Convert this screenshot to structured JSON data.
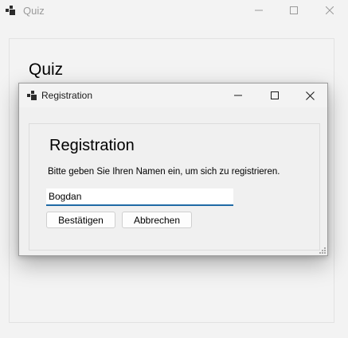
{
  "main_window": {
    "title": "Quiz",
    "heading": "Quiz",
    "icon": "app-window-icon"
  },
  "dialog": {
    "title": "Registration",
    "icon": "app-window-icon",
    "heading": "Registration",
    "instruction": "Bitte geben Sie Ihren Namen ein, um sich zu registrieren.",
    "name_input": {
      "value": "Bogdan",
      "placeholder": ""
    },
    "buttons": {
      "confirm_label": "Bestätigen",
      "cancel_label": "Abbrechen"
    }
  },
  "caption_icons": [
    "minimize-icon",
    "maximize-icon",
    "close-icon"
  ],
  "colors": {
    "window_background": "#f3f3f3",
    "dialog_background": "#f0f0f0",
    "input_accent": "#1f6aa5",
    "inactive_text": "#9a9a9a"
  }
}
